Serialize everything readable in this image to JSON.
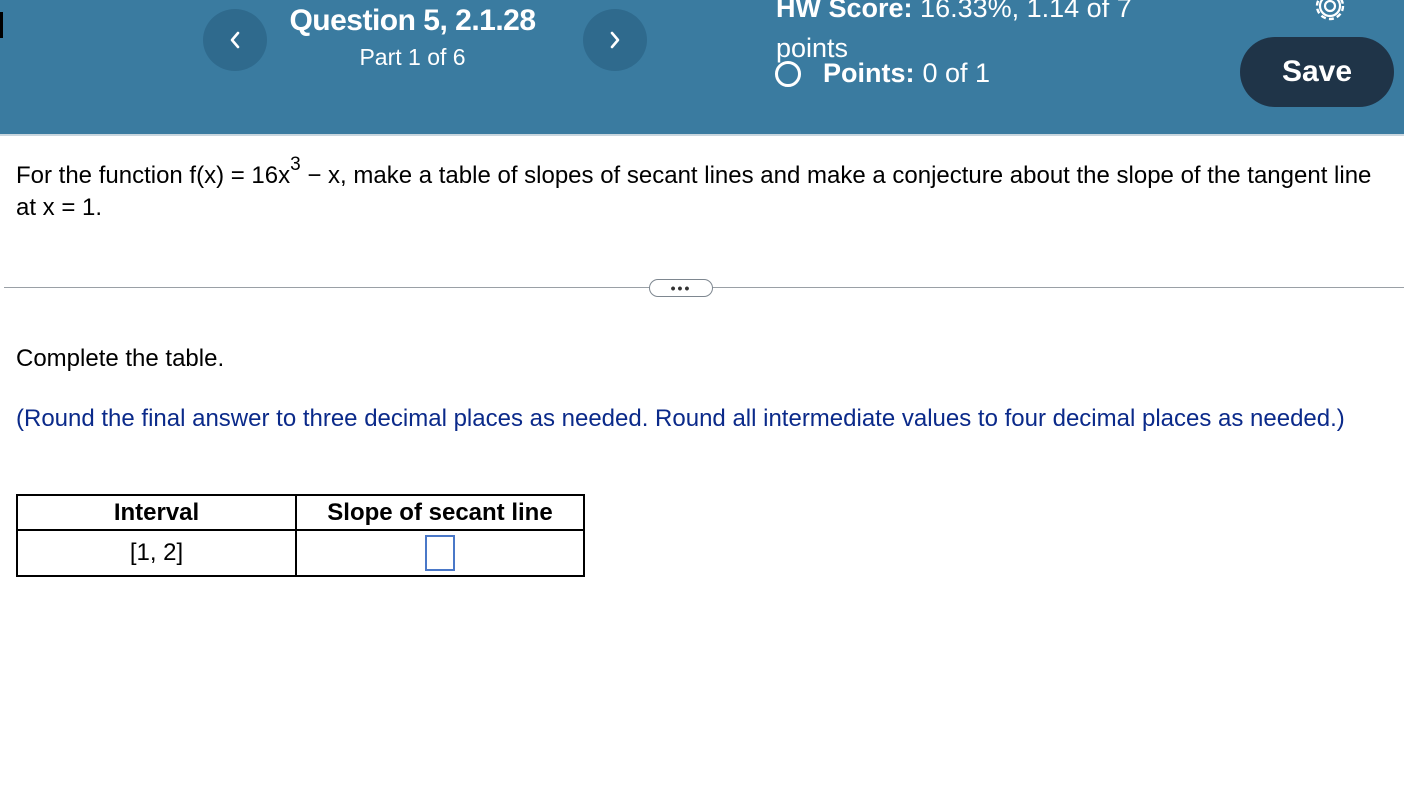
{
  "header": {
    "question_title": "Question 5, 2.1.28",
    "part": "Part 1 of 6",
    "hw_score_label": "HW Score:",
    "hw_score_value": "16.33%, 1.14 of 7",
    "hw_score_unit": "points",
    "points_label": "Points:",
    "points_value": "0 of 1",
    "save_label": "Save",
    "colors": {
      "bar": "#3a7ba0",
      "nav_button": "#2f6a8d",
      "save_button": "#1f3448"
    },
    "icons": {
      "prev": "chevron-left-icon",
      "next": "chevron-right-icon",
      "settings": "gear-icon",
      "status": "empty-circle-icon"
    }
  },
  "problem": {
    "text_before": "For the function f(x) = 16x",
    "exponent": "3",
    "text_after": " − x, make a table of slopes of secant lines and make a conjecture about the slope of the tangent line at x = 1."
  },
  "more_button": "•••",
  "instruction": "Complete the table.",
  "hint": "(Round the final answer to three decimal places as needed. Round all intermediate values to four decimal places as needed.)",
  "table": {
    "headers": [
      "Interval",
      "Slope of secant line"
    ],
    "rows": [
      {
        "interval": "[1, 2]",
        "slope": ""
      }
    ]
  }
}
